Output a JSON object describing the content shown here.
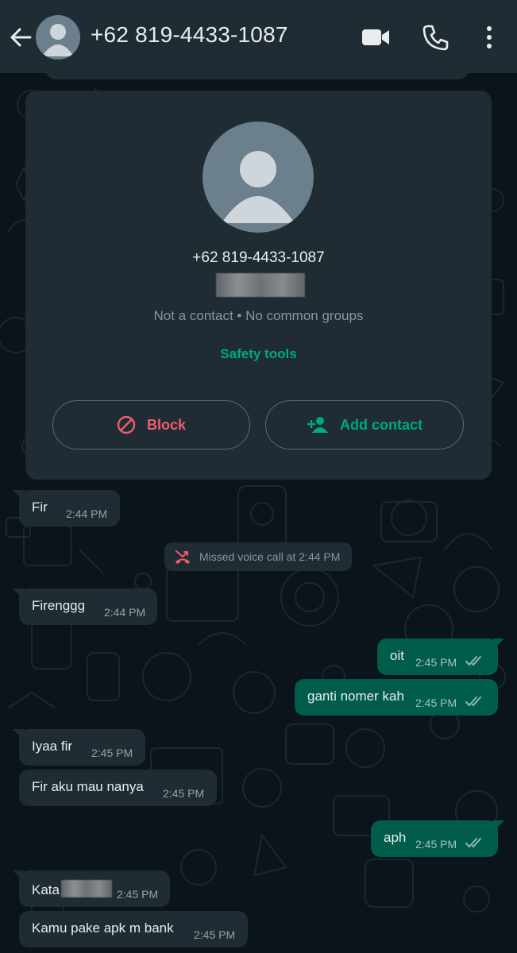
{
  "header": {
    "title": "+62 819-4433-1087",
    "icons": [
      "back-arrow-icon",
      "avatar",
      "video-call-icon",
      "voice-call-icon",
      "more-vert-icon"
    ]
  },
  "contact_card": {
    "number": "+62 819-4433-1087",
    "subtitle": "Not a contact • No common groups",
    "safety_link": "Safety tools",
    "block_label": "Block",
    "add_contact_label": "Add contact"
  },
  "messages": [
    {
      "dir": "in",
      "text": "Fir",
      "time": "2:44 PM"
    },
    {
      "dir": "in",
      "text": "Firenggg",
      "time": "2:44 PM"
    },
    {
      "dir": "out",
      "text": "oit",
      "time": "2:45 PM"
    },
    {
      "dir": "out",
      "text": "ganti nomer kah",
      "time": "2:45 PM"
    },
    {
      "dir": "in",
      "text": "Iyaa fir",
      "time": "2:45 PM"
    },
    {
      "dir": "in",
      "text": "Fir aku mau nanya",
      "time": "2:45 PM"
    },
    {
      "dir": "out",
      "text": "aph",
      "time": "2:45 PM"
    },
    {
      "dir": "in",
      "text": "Kata",
      "time": "2:45 PM"
    },
    {
      "dir": "in",
      "text": "Kamu pake apk m bank",
      "time": "2:45 PM"
    }
  ],
  "system_message": {
    "text": "Missed voice call at 2:44 PM",
    "icon": "missed-call-icon"
  },
  "colors": {
    "topbar": "#1f2c34",
    "background": "#0b141a",
    "incoming_bubble": "#1f2c34",
    "outgoing_bubble": "#005c4b",
    "accent_green": "#00a884",
    "block_red": "#f15c6d",
    "read_ticks": "#8fb8b0"
  }
}
